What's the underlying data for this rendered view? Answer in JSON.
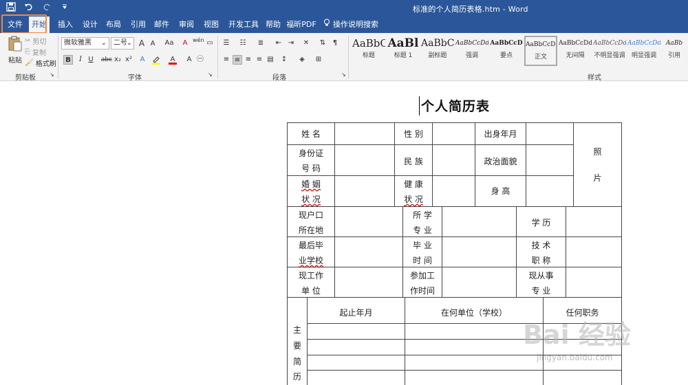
{
  "titlebar": {
    "save_icon": "save-icon",
    "undo_icon": "undo-icon",
    "redo_icon": "redo-icon",
    "qat_more_icon": "qat-dropdown-icon",
    "title": "标准的个人简历表格.htm  -  Word"
  },
  "tabs": [
    {
      "label": "文件"
    },
    {
      "label": "开始"
    },
    {
      "label": "插入"
    },
    {
      "label": "设计"
    },
    {
      "label": "布局"
    },
    {
      "label": "引用"
    },
    {
      "label": "邮件"
    },
    {
      "label": "审阅"
    },
    {
      "label": "视图"
    },
    {
      "label": "开发工具"
    },
    {
      "label": "帮助"
    },
    {
      "label": "福昕PDF"
    },
    {
      "label": "操作说明搜索"
    }
  ],
  "ribbon": {
    "clipboard": {
      "paste": "粘贴",
      "cut": "剪切",
      "copy": "复制",
      "format_painter": "格式刷",
      "group_label": "剪贴板"
    },
    "font": {
      "font_name": "微软雅黑",
      "font_size": "二号",
      "group_label": "字体",
      "bold": "B",
      "italic": "I",
      "underline": "U",
      "strike": "abc",
      "sub": "x₂",
      "sup": "x²",
      "grow": "A",
      "shrink": "A",
      "case": "Aa",
      "clear": "A",
      "wen": "wén",
      "font_color_label": "A"
    },
    "paragraph": {
      "group_label": "段落"
    },
    "styles": {
      "group_label": "样式",
      "items": [
        {
          "sample": "AaBbC",
          "name": "标题"
        },
        {
          "sample": "AaBl",
          "name": "标题 1"
        },
        {
          "sample": "AaBbC",
          "name": "副标题"
        },
        {
          "sample": "AaBbCcDd",
          "name": "强调"
        },
        {
          "sample": "AaBbCcD",
          "name": "要点"
        },
        {
          "sample": "AaBbCcDd",
          "name": "正文"
        },
        {
          "sample": "AaBbCcDd",
          "name": "无间隔"
        },
        {
          "sample": "AaBbCcDd",
          "name": "不明显强调"
        },
        {
          "sample": "AaBbCcDd",
          "name": "明显强调"
        },
        {
          "sample": "AaBb",
          "name": "引用"
        }
      ]
    }
  },
  "document": {
    "title": "个人简历表",
    "rows": {
      "r1": {
        "c1": "姓    名",
        "c3": "性    别",
        "c5": "出身年月",
        "photo1": "照",
        "photo2": "片"
      },
      "r2": {
        "c1a": "身份证",
        "c1b": "号    码",
        "c3": "民    族",
        "c5": "政治面貌"
      },
      "r3": {
        "c1a": "婚    姻",
        "c1b": "状    况",
        "c3a": "健    康",
        "c3b": "状    况",
        "c5": "身    高"
      },
      "r4": {
        "c1a": "现户口",
        "c1b": "所在地",
        "c3a": "所    学",
        "c3b": "专    业",
        "c5": "学    历"
      },
      "r5": {
        "c1a": "最后毕",
        "c1b": "业学校",
        "c3a": "毕    业",
        "c3b": "时    间",
        "c5a": "技    术",
        "c5b": "职    称"
      },
      "r6": {
        "c1a": "现工作",
        "c1b": "单    位",
        "c3a": "参加工",
        "c3b": "作时间",
        "c5a": "现从事",
        "c5b": "专    业"
      },
      "history": {
        "side1": "主",
        "side2": "要",
        "side3": "简",
        "side4": "历",
        "col1": "起止年月",
        "col2": "在何单位（学校）",
        "col3": "任何职务"
      }
    }
  },
  "watermark": {
    "main": "Bai 经验",
    "sub": "jingyan.baidu.com"
  },
  "colors": {
    "accent": "#2b579a",
    "highlight_box": "#f08a3a"
  }
}
